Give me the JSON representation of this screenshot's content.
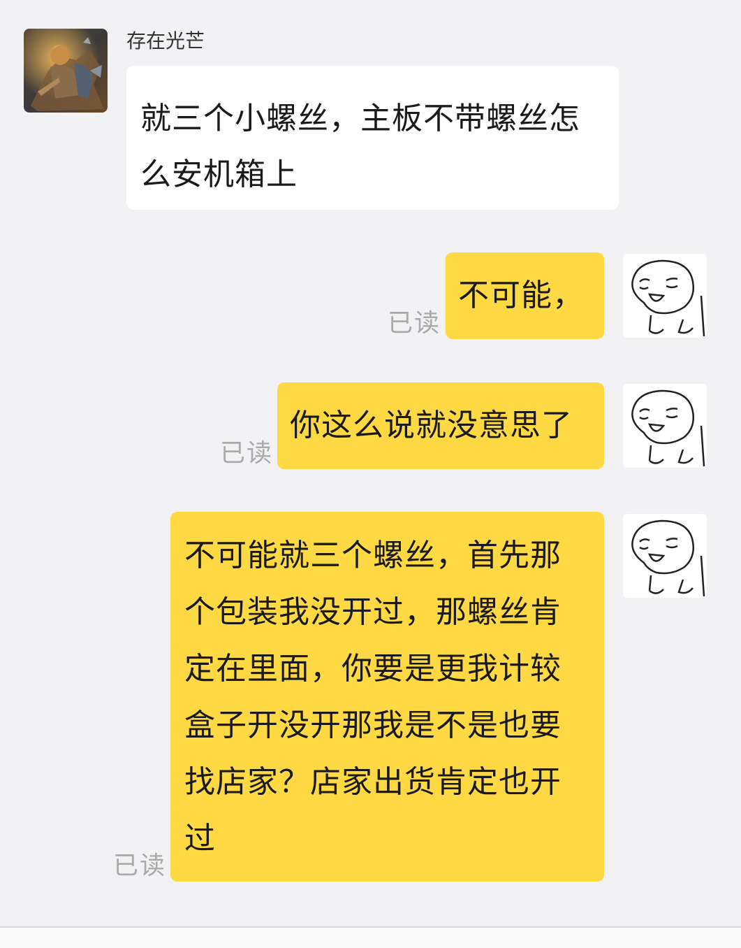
{
  "chat": {
    "contact_name": "存在光芒",
    "messages": [
      {
        "side": "incoming",
        "text": "就三个小螺丝，主板不带螺丝怎么安机箱上"
      },
      {
        "side": "outgoing",
        "text": "不可能，",
        "status": "已读"
      },
      {
        "side": "outgoing",
        "text": "你这么说就没意思了",
        "status": "已读"
      },
      {
        "side": "outgoing",
        "text": "不可能就三个螺丝，首先那个包装我没开过，那螺丝肯定在里面，你要是更我计较盒子开没开那我是不是也要找店家？店家出货肯定也开过",
        "status": "已读"
      }
    ]
  },
  "colors": {
    "background": "#f2f2f5",
    "incoming_bubble": "#ffffff",
    "outgoing_bubble": "#ffd944",
    "read_status": "#aaaaaa"
  },
  "icons": {
    "contact_avatar": "warrior-avatar-icon",
    "self_avatar": "doodle-face-avatar-icon"
  }
}
